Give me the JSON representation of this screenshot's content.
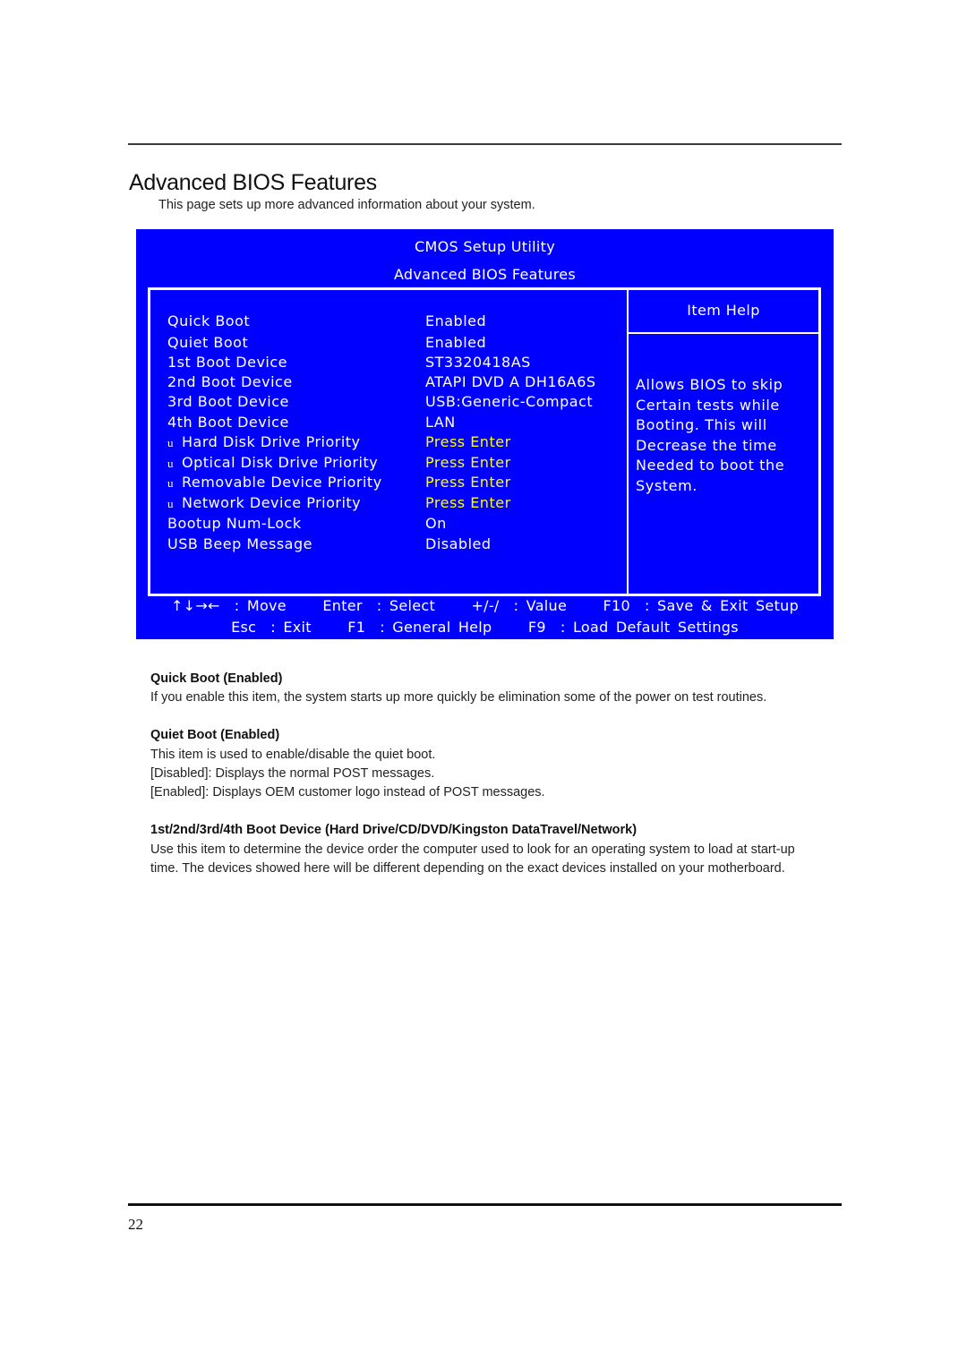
{
  "page": {
    "title": "Advanced BIOS Features",
    "subtitle": "This page sets up more advanced information about your system.",
    "page_number": "22"
  },
  "bios": {
    "header_title": "CMOS Setup Utility",
    "header_subtitle": "Advanced BIOS Features",
    "colors": {
      "background": "#0000ff",
      "text": "#ffffff",
      "submenu_value": "#ffff00"
    },
    "settings": [
      {
        "label": "Quick Boot",
        "value": "Enabled",
        "submenu": false
      },
      {
        "label": "Quiet Boot",
        "value": "Enabled",
        "submenu": false
      },
      {
        "label": "1st Boot Device",
        "value": "ST3320418AS",
        "submenu": false
      },
      {
        "label": "2nd Boot Device",
        "value": "ATAPI  DVD A DH16A6S",
        "submenu": false
      },
      {
        "label": "3rd Boot Device",
        "value": "USB:Generic-Compact",
        "submenu": false
      },
      {
        "label": "4th Boot Device",
        "value": "LAN",
        "submenu": false
      },
      {
        "label": "Hard Disk Drive Priority",
        "value": "Press Enter",
        "submenu": true,
        "bullet": "u"
      },
      {
        "label": "Optical Disk Drive Priority",
        "value": "Press Enter",
        "submenu": true,
        "bullet": "u"
      },
      {
        "label": "Removable Device Priority",
        "value": "Press Enter",
        "submenu": true,
        "bullet": "u"
      },
      {
        "label": "Network Device Priority",
        "value": "Press Enter",
        "submenu": true,
        "bullet": "u"
      },
      {
        "label": "Bootup Num-Lock",
        "value": "On",
        "submenu": false
      },
      {
        "label": "USB Beep Message",
        "value": "Disabled",
        "submenu": false
      }
    ],
    "item_help": {
      "title": "Item Help",
      "lines": [
        "Allows BIOS to skip",
        "Certain tests while",
        "Booting. This will",
        "Decrease the time",
        "Needed to boot the",
        "System."
      ]
    },
    "footer": {
      "line1": [
        {
          "key": "↑↓→←",
          "action": ": Move"
        },
        {
          "key": "Enter",
          "action": ": Select"
        },
        {
          "key": "+/-/",
          "action": ": Value"
        },
        {
          "key": "F10",
          "action": ": Save & Exit Setup"
        }
      ],
      "line2": [
        {
          "key": "Esc",
          "action": ":  Exit"
        },
        {
          "key": "F1",
          "action": ": General Help"
        },
        {
          "key": "F9",
          "action": ": Load Default Settings"
        }
      ]
    }
  },
  "sections": [
    {
      "heading": "Quick Boot (Enabled)",
      "body": [
        "If you enable this item, the system starts up more quickly be elimination some of the power on test routines."
      ]
    },
    {
      "heading": "Quiet Boot (Enabled)",
      "body": [
        "This item is used to enable/disable the quiet boot.",
        "[Disabled]: Displays the normal POST messages.",
        "[Enabled]: Displays OEM customer logo instead of POST messages."
      ]
    },
    {
      "heading": "1st/2nd/3rd/4th Boot Device (Hard Drive/CD/DVD/Kingston DataTravel/Network)",
      "body": [
        "Use this item to determine the device order the computer used to look for an operating system to load at start-up time. The devices showed here will be different depending on the exact devices installed on your motherboard."
      ]
    }
  ]
}
